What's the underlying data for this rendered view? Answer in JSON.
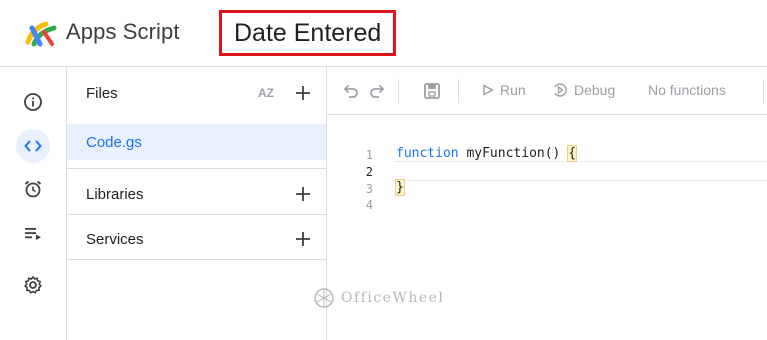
{
  "header": {
    "app_name": "Apps Script",
    "project_title": "Date Entered",
    "logo_icon": "apps-script-logo",
    "highlight_color": "#e0141c"
  },
  "rail": {
    "items": [
      {
        "icon": "info-icon",
        "label": "Overview",
        "active": false
      },
      {
        "icon": "code-icon",
        "label": "Editor",
        "active": true
      },
      {
        "icon": "alarm-clock-icon",
        "label": "Triggers",
        "active": false
      },
      {
        "icon": "executions-icon",
        "label": "Executions",
        "active": false
      },
      {
        "icon": "gear-icon",
        "label": "Project Settings",
        "active": false
      }
    ]
  },
  "files_panel": {
    "files_header": "Files",
    "sort_label": "AZ",
    "files": [
      {
        "name": "Code.gs",
        "selected": true
      }
    ],
    "libraries_label": "Libraries",
    "services_label": "Services"
  },
  "toolbar": {
    "run_label": "Run",
    "debug_label": "Debug",
    "function_select": "No functions"
  },
  "editor": {
    "line_numbers": [
      "1",
      "2",
      "3",
      "4"
    ],
    "current_line": "2",
    "keyword": "function",
    "line1_rest": " myFunction() ",
    "open_brace": "{",
    "close_brace": "}"
  },
  "watermark": {
    "text": "OfficeWheel"
  },
  "colors": {
    "accent": "#1a73e8",
    "selected_bg": "#e8f0fe",
    "divider": "#dadce0"
  }
}
